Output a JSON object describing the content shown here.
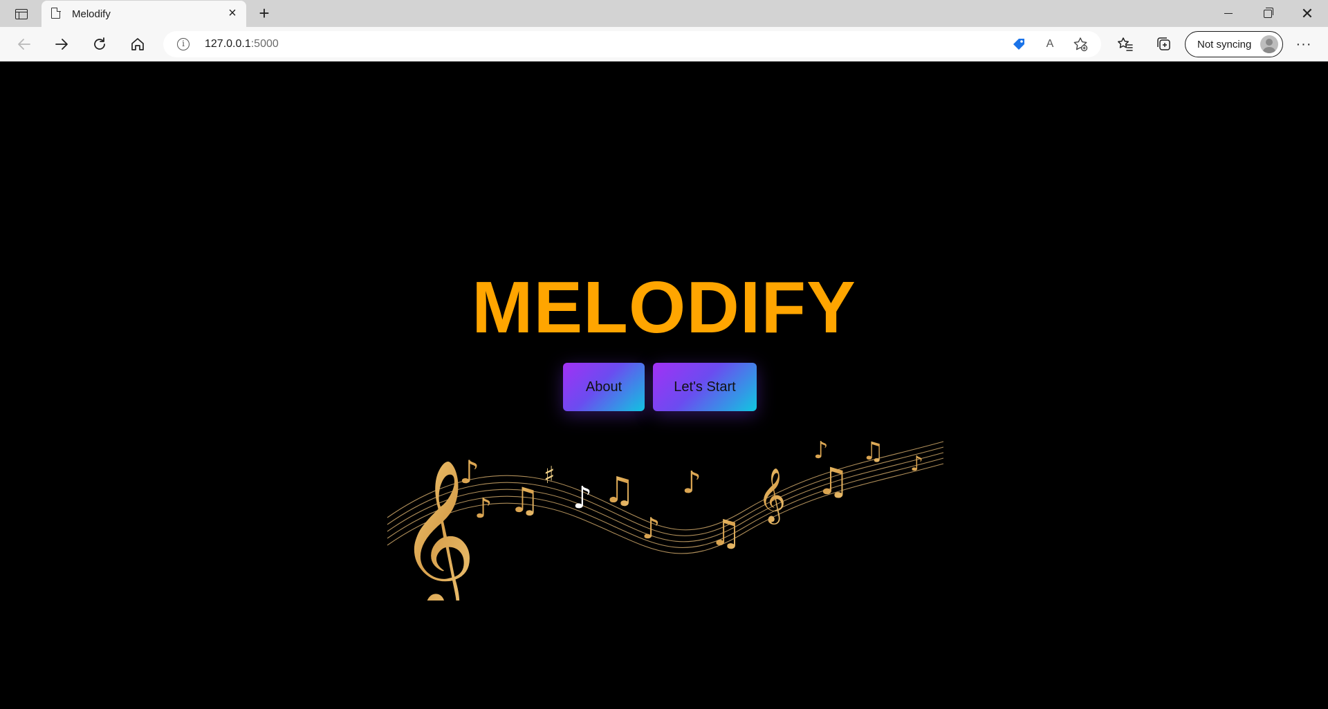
{
  "browser": {
    "tab": {
      "title": "Melodify",
      "close_glyph": "×"
    },
    "new_tab_glyph": "+",
    "window_controls": {
      "close_glyph": "✕"
    },
    "address": {
      "host": "127.0.0.1",
      "port": ":5000",
      "info_glyph": "i"
    },
    "read_aloud_glyph": "A",
    "sync": {
      "label": "Not syncing"
    },
    "more_glyph": "···"
  },
  "page": {
    "title": "MELODIFY",
    "buttons": {
      "about": "About",
      "start": "Let's Start"
    }
  },
  "colors": {
    "title": "#ffa500",
    "background": "#000000",
    "button_gradient": [
      "#a231f5",
      "#6b4cf0",
      "#10c7e0"
    ],
    "notes_gold": "#e6b86a"
  },
  "icons": {
    "browser": [
      "tab-actions-icon",
      "page-icon",
      "close-icon",
      "plus-icon",
      "minimize-icon",
      "restore-icon",
      "back-icon",
      "forward-icon",
      "reload-icon",
      "home-icon",
      "info-icon",
      "price-tag-icon",
      "read-aloud-icon",
      "add-favorite-icon",
      "favorites-icon",
      "collections-icon",
      "avatar-icon",
      "more-icon"
    ],
    "decoration": [
      "treble-clef-icon",
      "sharp-icon",
      "music-note-icon"
    ]
  }
}
